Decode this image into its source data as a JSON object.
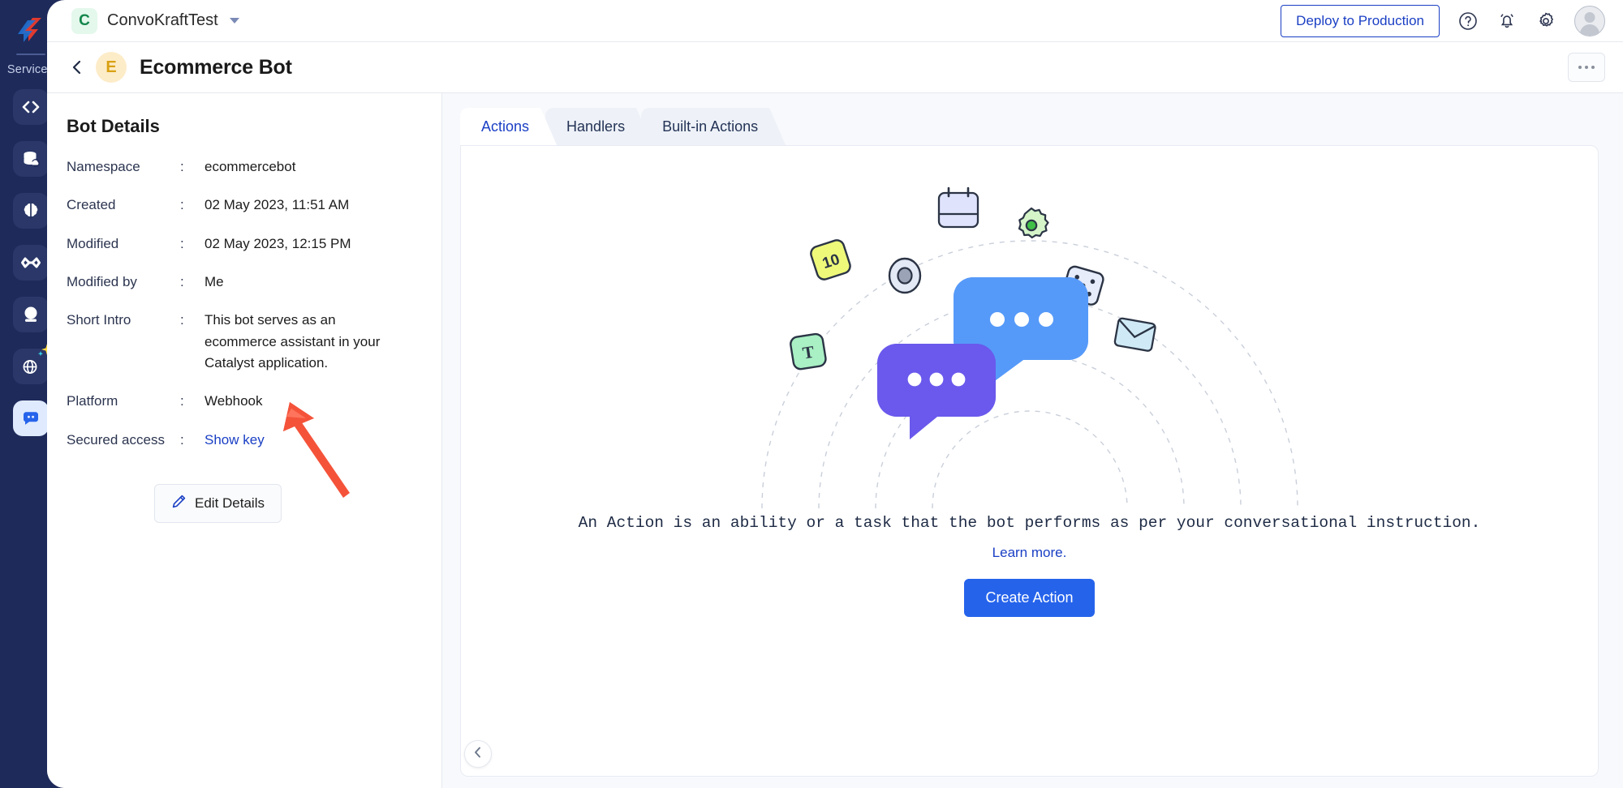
{
  "rail": {
    "logo_icon": "catalyst-logo-icon",
    "services_label": "Services",
    "items": [
      {
        "icon": "code-brackets-icon",
        "name": "develop"
      },
      {
        "icon": "database-cloud-icon",
        "name": "data-store"
      },
      {
        "icon": "brain-icon",
        "name": "ai-services"
      },
      {
        "icon": "infinity-devops-icon",
        "name": "devops"
      },
      {
        "icon": "crystal-ball-icon",
        "name": "insights"
      },
      {
        "icon": "globe-sparkle-icon",
        "name": "web-ai"
      },
      {
        "icon": "chat-bubble-icon",
        "name": "conversations"
      }
    ]
  },
  "topbar": {
    "org_initial": "C",
    "org_name": "ConvoKraftTest",
    "org_dropdown_icon": "chevron-down-icon",
    "deploy_label": "Deploy to Production",
    "help_icon": "question-circle-icon",
    "notifications_icon": "bell-icon",
    "settings_icon": "gear-icon",
    "avatar_icon": "user-avatar-icon"
  },
  "page_header": {
    "back_icon": "chevron-left-icon",
    "bot_initial": "E",
    "title": "Ecommerce Bot",
    "more_icon": "ellipsis-icon"
  },
  "details": {
    "title": "Bot Details",
    "rows": [
      {
        "label": "Namespace",
        "colon": ":",
        "value": "ecommercebot",
        "link": false
      },
      {
        "label": "Created",
        "colon": ":",
        "value": "02 May 2023, 11:51 AM",
        "link": false
      },
      {
        "label": "Modified",
        "colon": ":",
        "value": "02 May 2023, 12:15 PM",
        "link": false
      },
      {
        "label": "Modified by",
        "colon": ":",
        "value": "Me",
        "link": false
      },
      {
        "label": "Short Intro",
        "colon": ":",
        "value": "This bot serves as an ecommerce assistant in your Catalyst application.",
        "link": false
      },
      {
        "label": "Platform",
        "colon": ":",
        "value": "Webhook",
        "link": false
      },
      {
        "label": "Secured access",
        "colon": ":",
        "value": "Show key",
        "link": true
      }
    ],
    "edit_label": "Edit Details",
    "edit_icon": "pencil-icon"
  },
  "tabs": [
    {
      "label": "Actions",
      "active": true
    },
    {
      "label": "Handlers",
      "active": false
    },
    {
      "label": "Built-in Actions",
      "active": false
    }
  ],
  "empty_state": {
    "description": "An Action is an ability or a task that the bot performs as per your conversational instruction.",
    "learn_more": "Learn more.",
    "cta_label": "Create Action",
    "illustration_icon": "chat-bubbles-illustration"
  },
  "collapse": {
    "icon": "chevron-left-icon"
  },
  "colors": {
    "rail_bg": "#1e2a5a",
    "accent_blue": "#1a3fc4",
    "cta_blue": "#2563eb",
    "panel_bg": "#f7f9fc",
    "arrow_red": "#f4533a"
  }
}
